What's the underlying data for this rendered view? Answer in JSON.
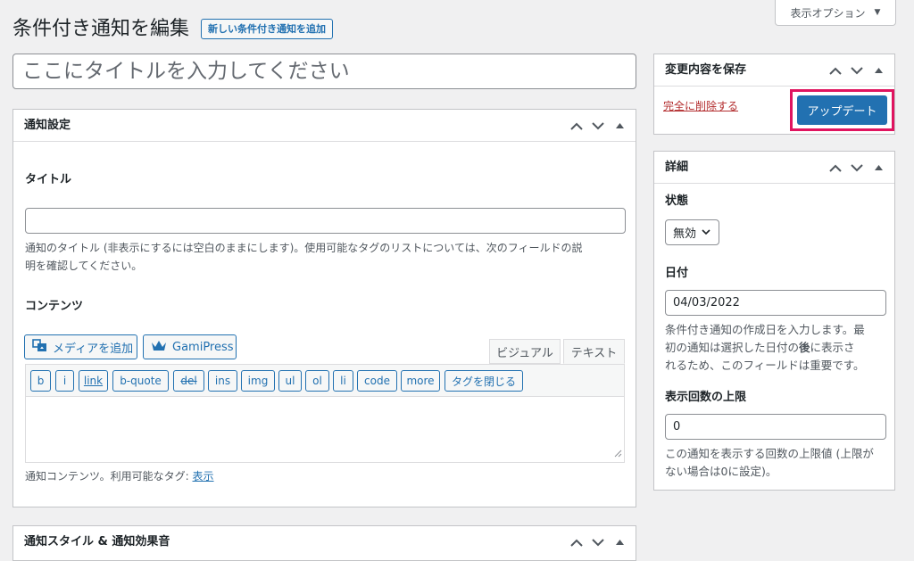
{
  "header": {
    "title": "条件付き通知を編集",
    "add_new_label": "新しい条件付き通知を追加",
    "screen_options_label": "表示オプション"
  },
  "title_field": {
    "placeholder": "ここにタイトルを入力してください",
    "value": ""
  },
  "notification_settings": {
    "box_title": "通知設定",
    "title_label": "タイトル",
    "title_value": "",
    "title_desc_line1": "通知のタイトル (非表示にするには空白のままにします)。使用可能なタグのリストについては、次のフィールドの説",
    "title_desc_line2": "明を確認してください。",
    "content_label": "コンテンツ",
    "add_media_label": "メディアを追加",
    "gamipress_label": "GamiPress",
    "tab_visual": "ビジュアル",
    "tab_text": "テキスト",
    "quicktags": [
      "b",
      "i",
      "link",
      "b-quote",
      "del",
      "ins",
      "img",
      "ul",
      "ol",
      "li",
      "code",
      "more",
      "タグを閉じる"
    ],
    "content_desc_prefix": "通知コンテンツ。利用可能なタグ:",
    "content_desc_link": "表示"
  },
  "style_box": {
    "box_title": "通知スタイル & 通知効果音"
  },
  "save_box": {
    "box_title": "変更内容を保存",
    "delete_label": "完全に削除する",
    "update_label": "アップデート"
  },
  "details_box": {
    "box_title": "詳細",
    "status_label": "状態",
    "status_value": "無効",
    "date_label": "日付",
    "date_value": "04/03/2022",
    "date_desc_line1": "条件付き通知の作成日を入力します。最",
    "date_desc_line2": "初の通知は選択した日付の",
    "date_desc_bold": "後",
    "date_desc_line2b": "に表示さ",
    "date_desc_line3": "れるため、このフィールドは重要です。",
    "limit_label": "表示回数の上限",
    "limit_value": "0",
    "limit_desc_line1": "この通知を表示する回数の上限値 (上限が",
    "limit_desc_line2": "ない場合は0に設定)。"
  },
  "colors": {
    "accent": "#2271b1",
    "delete": "#b32d2e",
    "highlight": "#e0145f"
  },
  "icons": [
    "caret-down-icon",
    "chevron-up-icon",
    "chevron-down-icon",
    "triangle-up-icon",
    "add-media-icon",
    "crown-icon",
    "resize-handle-icon"
  ]
}
